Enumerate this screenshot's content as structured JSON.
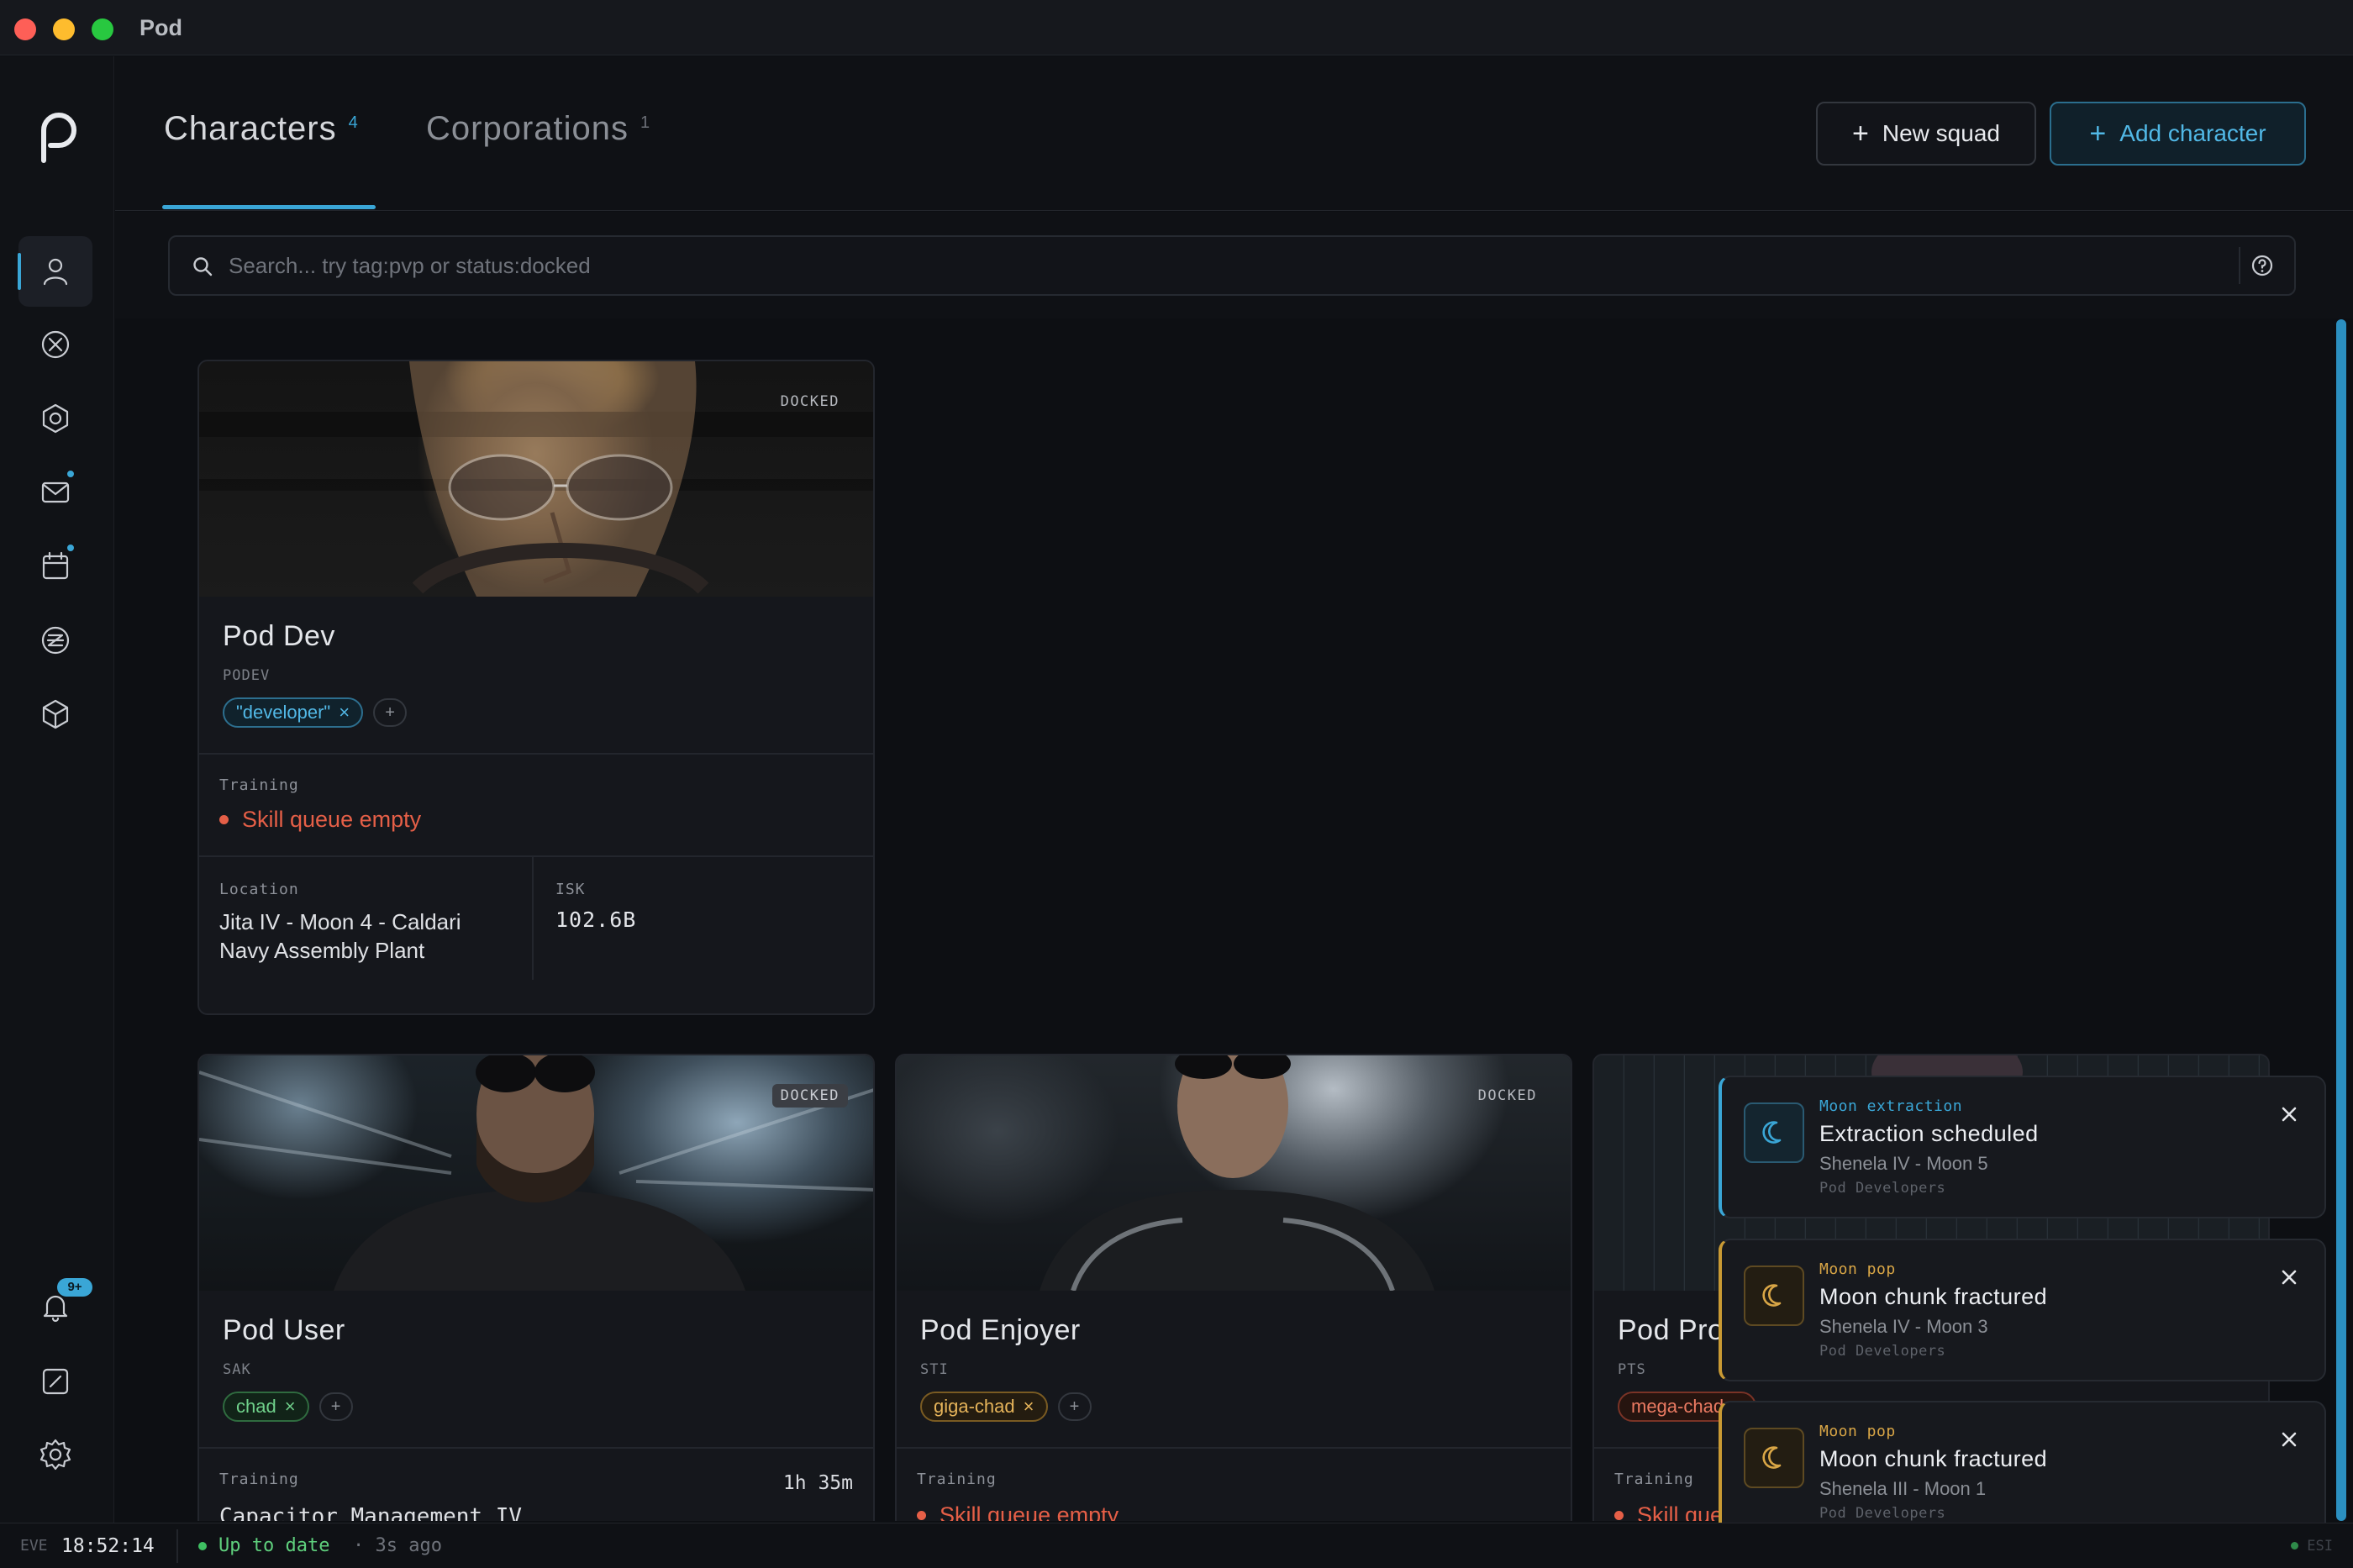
{
  "window": {
    "title": "Pod"
  },
  "header": {
    "tabs": [
      {
        "label": "Characters",
        "count": "4",
        "active": true
      },
      {
        "label": "Corporations",
        "count": "1",
        "active": false
      }
    ],
    "buttons": {
      "new_squad": "New squad",
      "add_character": "Add character"
    }
  },
  "sidebar": {
    "items": [
      {
        "icon": "user-icon",
        "active": true
      },
      {
        "icon": "crosshair-x-icon"
      },
      {
        "icon": "hexagon-gear-icon"
      },
      {
        "icon": "mail-icon",
        "dot": true
      },
      {
        "icon": "calendar-icon",
        "dot": true
      },
      {
        "icon": "isk-coin-icon"
      },
      {
        "icon": "cube-icon"
      }
    ],
    "bottom": [
      {
        "icon": "bell-icon",
        "badge": "9+"
      },
      {
        "icon": "gauge-icon"
      },
      {
        "icon": "settings-gear-icon"
      }
    ]
  },
  "search": {
    "placeholder": "Search... try tag:pvp or status:docked"
  },
  "labels": {
    "docked": "DOCKED",
    "training": "Training",
    "location": "Location",
    "isk": "ISK"
  },
  "characters": [
    {
      "name": "Pod Dev",
      "ticker": "PODEV",
      "tags": [
        {
          "text": "\"developer\"",
          "color": "#52b8e6"
        }
      ],
      "training": "Skill queue empty",
      "location": "Jita IV - Moon 4 - Caldari Navy Assembly Plant",
      "isk": "102.6B",
      "docked": true
    },
    {
      "name": "Pod User",
      "ticker": "SAK",
      "tags": [
        {
          "text": "chad",
          "color": "#6fd08a"
        }
      ],
      "training_timer": "1h 35m",
      "training_skill": "Capacitor Management IV",
      "docked": true
    },
    {
      "name": "Pod Enjoyer",
      "ticker": "STI",
      "tags": [
        {
          "text": "giga-chad",
          "color": "#e6b45a"
        }
      ],
      "training": "Skill queue empty",
      "docked": true
    },
    {
      "name": "Pod Pro",
      "ticker": "PTS",
      "tags": [
        {
          "text": "mega-chad",
          "color": "#ea7a62"
        }
      ],
      "training": "Skill queue empty"
    }
  ],
  "toasts": [
    {
      "kind": "Moon extraction",
      "title": "Extraction scheduled",
      "location": "Shenela IV - Moon 5",
      "org": "Pod Developers",
      "accent": "#3aa6d6"
    },
    {
      "kind": "Moon pop",
      "title": "Moon chunk fractured",
      "location": "Shenela IV - Moon 3",
      "org": "Pod Developers",
      "accent": "#d9a646"
    },
    {
      "kind": "Moon pop",
      "title": "Moon chunk fractured",
      "location": "Shenela III - Moon 1",
      "org": "Pod Developers",
      "accent": "#d9a646"
    }
  ],
  "statusbar": {
    "eve_label": "EVE",
    "time": "18:52:14",
    "status": "Up to date",
    "ago": "· 3s ago",
    "esi": "ESI"
  }
}
